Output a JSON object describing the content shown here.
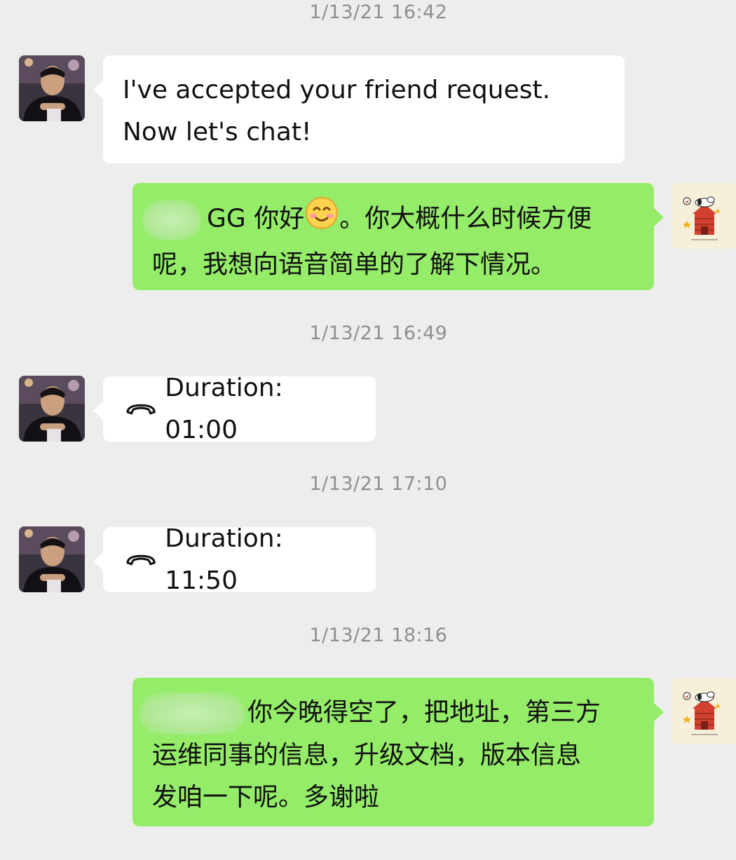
{
  "conversation": {
    "messages": [
      {
        "type": "timestamp",
        "text": "1/13/21 16:42"
      },
      {
        "type": "text",
        "side": "left",
        "avatar_icon": "contact-avatar-photo",
        "text": "I've accepted your friend request. Now let's chat!"
      },
      {
        "type": "text",
        "side": "right",
        "avatar_icon": "snoopy-avatar",
        "text_line1": "GG 你好",
        "text_line1_rest": "。你大概什么时候方便",
        "text_line2": "呢，我想向语音简单的了解下情况。",
        "emoji_icon": "smile-emoji-icon"
      },
      {
        "type": "timestamp",
        "text": "1/13/21 16:49"
      },
      {
        "type": "call",
        "side": "left",
        "avatar_icon": "contact-avatar-photo",
        "call_icon": "phone-hangup-icon",
        "text": "Duration: 01:00"
      },
      {
        "type": "timestamp",
        "text": "1/13/21 17:10"
      },
      {
        "type": "call",
        "side": "left",
        "avatar_icon": "contact-avatar-photo",
        "call_icon": "phone-hangup-icon",
        "text": "Duration: 11:50"
      },
      {
        "type": "timestamp",
        "text": "1/13/21 18:16"
      },
      {
        "type": "text",
        "side": "right",
        "avatar_icon": "snoopy-avatar",
        "text_line1": "你今晚得空了，把地址，第三方",
        "text_line2": "运维同事的信息，升级文档，版本信息",
        "text_line3": "发咱一下呢。多谢啦"
      }
    ]
  },
  "colors": {
    "background": "#ededed",
    "bubble_left": "#ffffff",
    "bubble_right": "#95ec69",
    "timestamp": "#8f8f8f"
  }
}
